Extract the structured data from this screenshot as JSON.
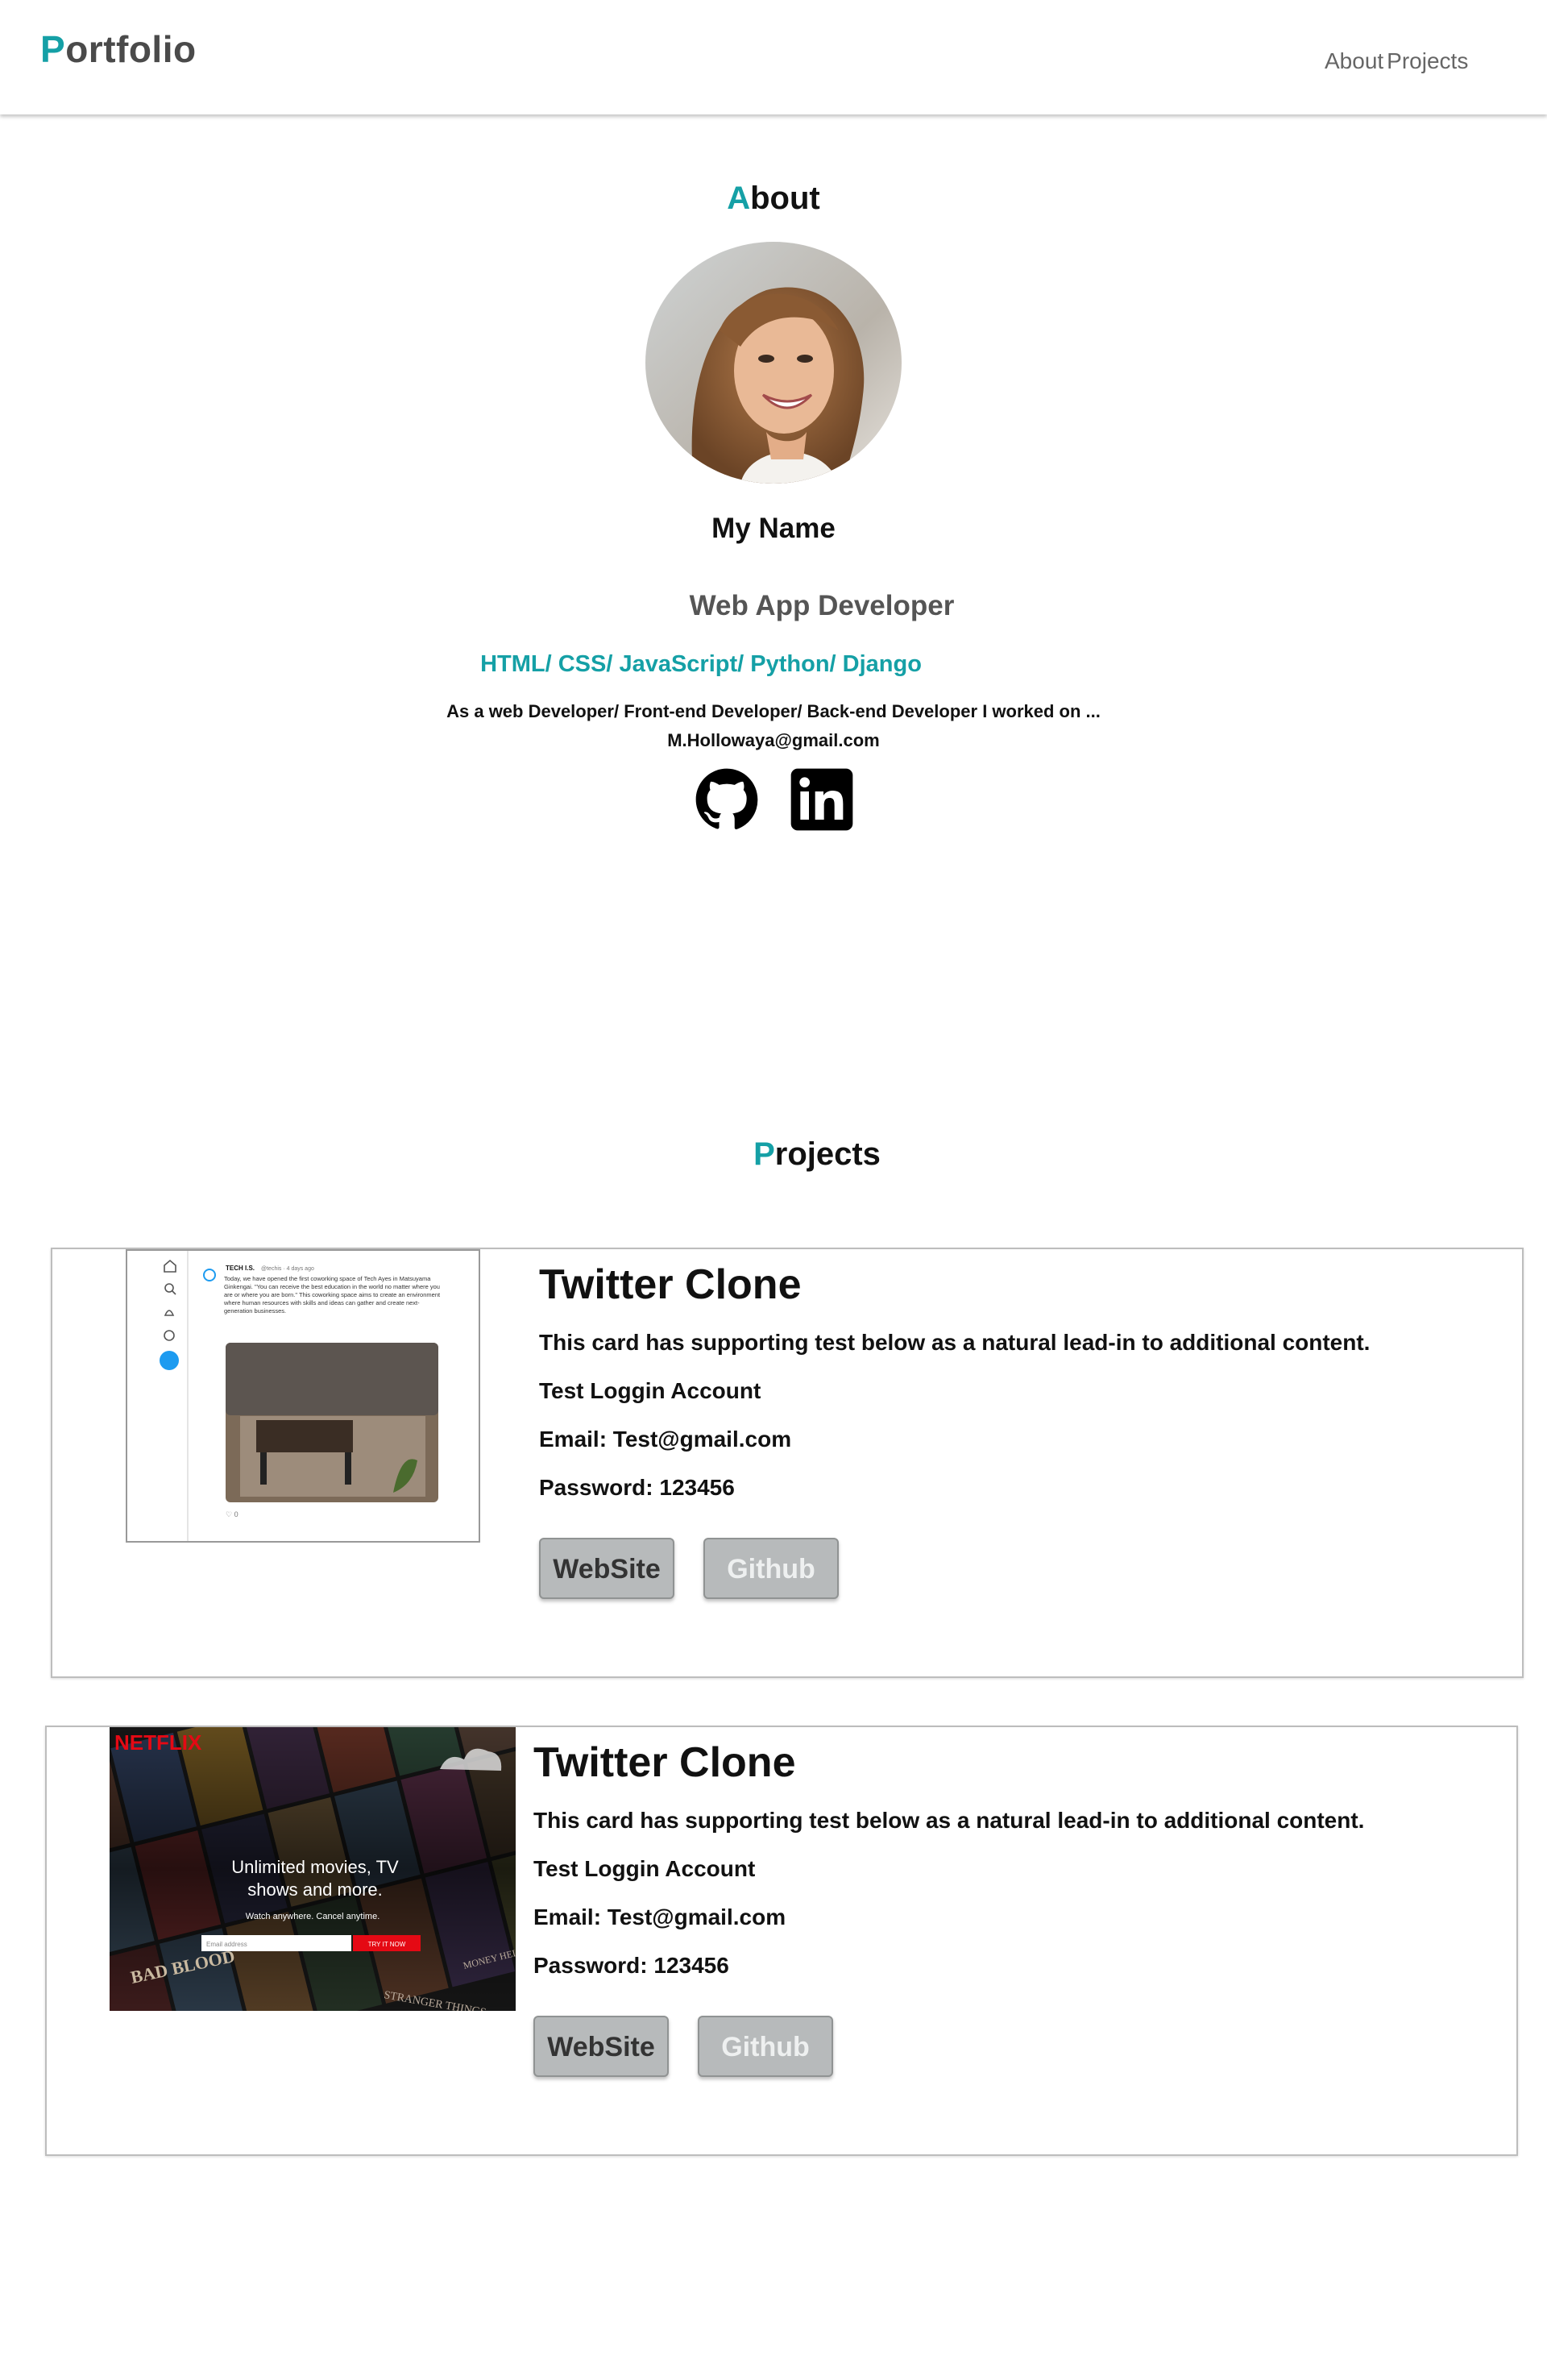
{
  "header": {
    "brand_initial": "P",
    "brand_rest": "ortfolio",
    "nav": [
      "About",
      "Projects"
    ]
  },
  "about": {
    "title_initial": "A",
    "title_rest": "bout",
    "name": "My Name",
    "role": "Web App Developer",
    "skills": "HTML/ CSS/ JavaScript/ Python/ Django",
    "bio": "As a web Developer/ Front-end Developer/ Back-end Developer I worked on ...",
    "email": "M.Hollowaya@gmail.com",
    "socials": [
      "github-icon",
      "linkedin-icon"
    ]
  },
  "projects": {
    "title_initial": "P",
    "title_rest": "rojects",
    "cards": [
      {
        "title": "Twitter Clone",
        "description": "This card has supporting test below as a natural lead-in to additional content.",
        "test_account": "Test Loggin Account",
        "email": "Email: Test@gmail.com",
        "password": "Password: 123456",
        "website_label": "WebSite",
        "github_label": "Github",
        "thumb": {
          "user": "TECH I.S.",
          "handle": "@techis · 4 days ago",
          "tweet": "Today, we have opened the first coworking space of Tech Ayes in Matsuyama Ginkengai. \"You can receive the best education in the world no matter where you are or where you are born.\" This coworking space aims to create an environment where human resources with skills and ideas can gather and create next-generation businesses.",
          "likes": "0"
        }
      },
      {
        "title": "Twitter Clone",
        "description": "This card has supporting test below as a natural lead-in to additional content.",
        "test_account": "Test Loggin Account",
        "email": "Email: Test@gmail.com",
        "password": "Password: 123456",
        "website_label": "WebSite",
        "github_label": "Github",
        "thumb": {
          "logo": "NETFLIX",
          "headline": "Unlimited movies, TV shows and more.",
          "sub": "Watch anywhere. Cancel anytime.",
          "placeholder": "Email address",
          "cta": "TRY IT NOW",
          "poster_blood": "BAD BLOOD",
          "poster_stranger": "STRANGER THINGS",
          "poster_money": "MONEY HEIST"
        }
      }
    ]
  },
  "colors": {
    "accent": "#15a0a6",
    "netflix_red": "#e50914",
    "button_bg": "#b7babb"
  }
}
